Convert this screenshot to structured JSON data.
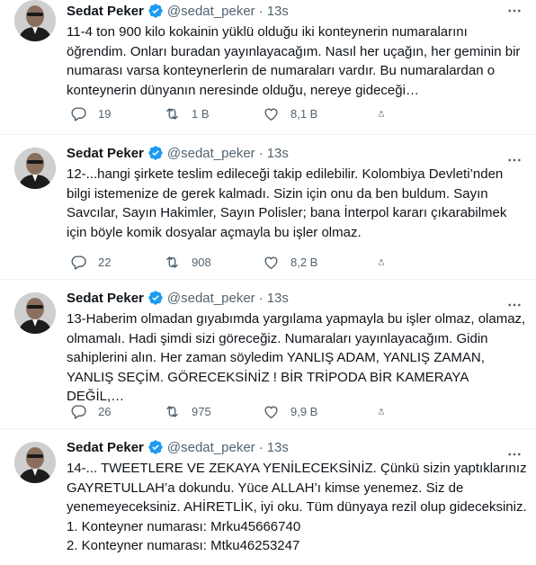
{
  "colors": {
    "text": "#0f1419",
    "muted": "#536471",
    "verified": "#1d9bf0",
    "divider": "#eff3f4"
  },
  "icons": {
    "verified": "verified-badge-icon",
    "more": "more-icon",
    "reply": "reply-icon",
    "retweet": "retweet-icon",
    "like": "heart-icon",
    "share": "share-icon"
  },
  "tweets": [
    {
      "name": "Sedat Peker",
      "handle": "@sedat_peker",
      "dot": "·",
      "time": "13s",
      "lines": [
        "11-4 ton 900 kilo kokainin yüklü olduğu iki konteynerin numaralarını",
        "öğrendim. Onları buradan yayınlayacağım. Nasıl her uçağın, her geminin bir",
        "numarası varsa konteynerlerin de numaraları vardır. Bu numaralardan o",
        "konteynerin dünyanın neresinde olduğu, nereye gideceği…"
      ],
      "replies": "19",
      "retweets": "1 B",
      "likes": "8,1 B"
    },
    {
      "name": "Sedat Peker",
      "handle": "@sedat_peker",
      "dot": "·",
      "time": "13s",
      "lines": [
        "12-...hangi şirkete teslim edileceği takip edilebilir. Kolombiya Devleti’nden",
        "bilgi istemenize de gerek kalmadı. Sizin için onu da ben buldum. Sayın",
        "Savcılar, Sayın Hakimler, Sayın Polisler; bana İnterpol kararı çıkarabilmek",
        "için böyle komik dosyalar açmayla bu işler olmaz."
      ],
      "replies": "22",
      "retweets": "908",
      "likes": "8,2 B"
    },
    {
      "name": "Sedat Peker",
      "handle": "@sedat_peker",
      "dot": "·",
      "time": "13s",
      "lines": [
        "13-Haberim olmadan gıyabımda yargılama yapmayla bu işler olmaz, olamaz,",
        "olmamalı. Hadi şimdi sizi göreceğiz. Numaraları yayınlayacağım. Gidin",
        "sahiplerini alın. Her zaman söyledim YANLIŞ ADAM, YANLIŞ ZAMAN,",
        "YANLIŞ SEÇİM. GÖRECEKSİNİZ ! BİR TRİPODA BİR KAMERAYA DEĞİL,…"
      ],
      "replies": "26",
      "retweets": "975",
      "likes": "9,9 B"
    },
    {
      "name": "Sedat Peker",
      "handle": "@sedat_peker",
      "dot": "·",
      "time": "13s",
      "lines": [
        "14-... TWEETLERE VE ZEKAYA YENİLECEKSİNİZ. Çünkü sizin yaptıklarınız",
        "GAYRETULLAH’a dokundu. Yüce ALLAH’ı kimse yenemez. Siz de",
        "yenemeyeceksiniz. AHİRETLİK, iyi oku. Tüm dünyaya rezil olup gideceksiniz.",
        "1. Konteyner numarası: Mrku45666740",
        "2. Konteyner numarası: Mtku46253247"
      ]
    }
  ]
}
